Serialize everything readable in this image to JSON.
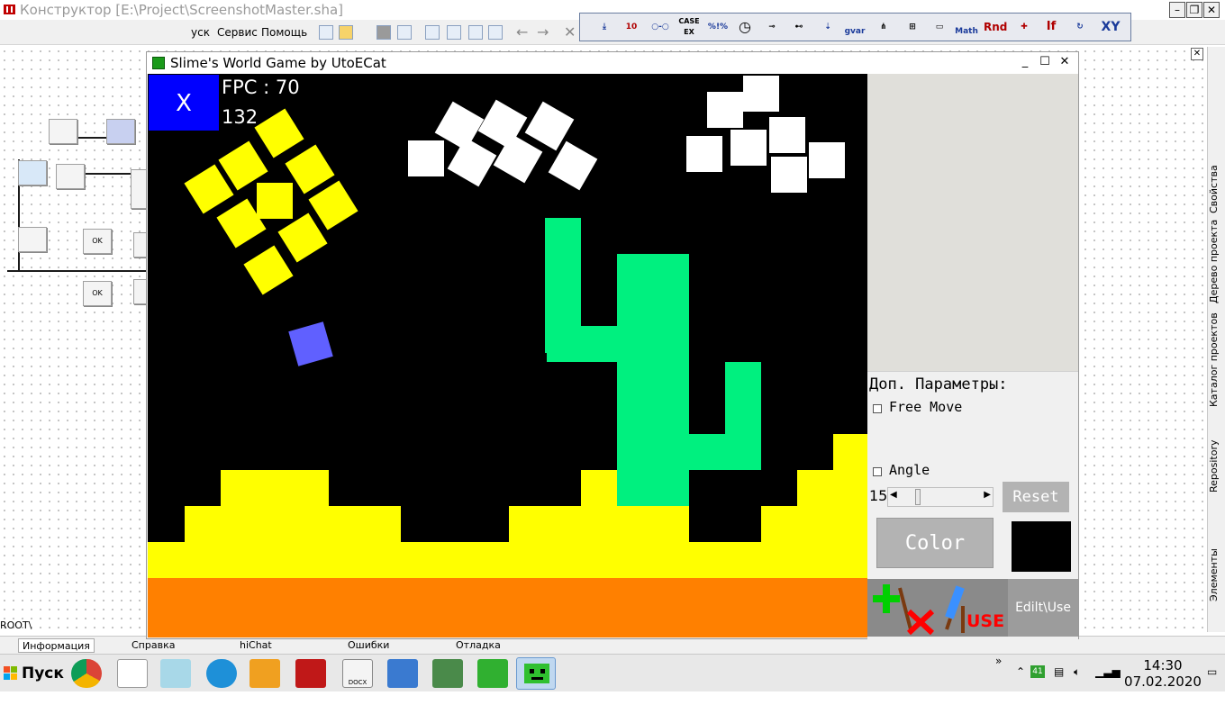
{
  "ide": {
    "title": "Конструктор [E:\\Project\\ScreenshotMaster.sha]",
    "menu": [
      "уск",
      "Сервис",
      "Помощь"
    ],
    "toolbar": {
      "case_label": "CASE EX",
      "math_label": "Math",
      "rnd_label": "Rnd",
      "if_label": "If",
      "xy_label": "XY",
      "gvar_label": "gvar",
      "percent_label": "%!%"
    },
    "root_label": "ROOT\\",
    "bottom_tabs": [
      "Информация",
      "Справка",
      "hiChat",
      "Ошибки",
      "Отладка"
    ],
    "right_tabs": [
      "Свойства",
      "Дерево проекта",
      "Каталог проектов",
      "Repository",
      "Элементы"
    ],
    "node_ok_label": "OK"
  },
  "game": {
    "title": "Slime's World Game by UtoECat",
    "close_button_label": "X",
    "fps_text": "FPC : 70",
    "counter_text": "132",
    "panel": {
      "params_title": "Доп. Параметры:",
      "free_move_label": "Free Move",
      "free_move_checked": false,
      "angle_label": "Angle",
      "angle_checked": false,
      "angle_value": "15",
      "reset_label": "Reset",
      "color_label": "Color",
      "current_color": "#000000",
      "use_label": "USE",
      "edit_use_label": "Edilt\\Use"
    },
    "colors": {
      "sky": "#000000",
      "sand": "#ffff00",
      "ground": "#ff8000",
      "cactus": "#00f07f",
      "sun": "#ffff00",
      "cloud": "#ffffff",
      "player": "#6060ff",
      "close_button": "#0000ff"
    }
  },
  "taskbar": {
    "start_label": "Пуск",
    "time": "14:30",
    "date": "07.02.2020",
    "badge": "41",
    "docx_label": "DOCX"
  }
}
